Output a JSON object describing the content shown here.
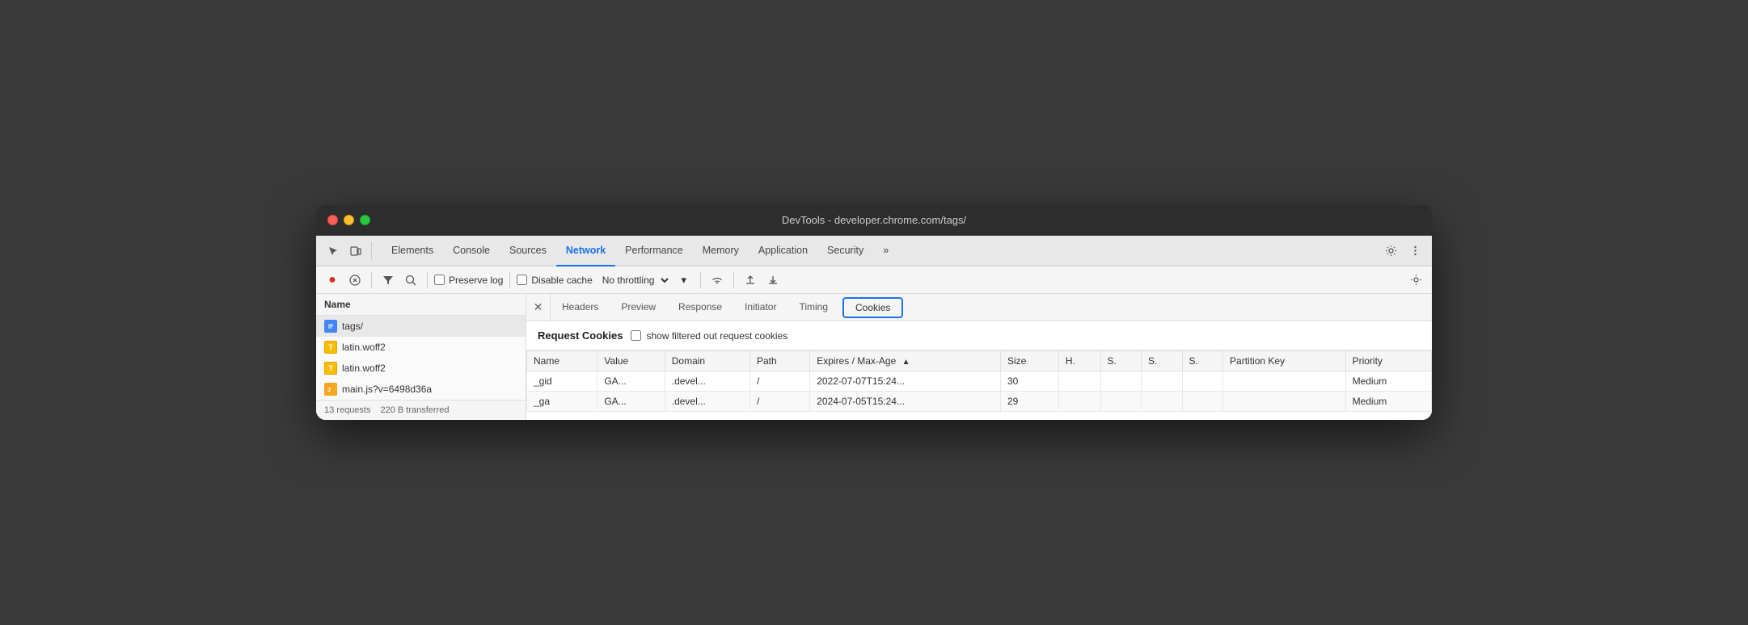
{
  "window": {
    "title": "DevTools - developer.chrome.com/tags/"
  },
  "tabs_bar": {
    "tabs": [
      {
        "label": "Elements",
        "active": false
      },
      {
        "label": "Console",
        "active": false
      },
      {
        "label": "Sources",
        "active": false
      },
      {
        "label": "Network",
        "active": true
      },
      {
        "label": "Performance",
        "active": false
      },
      {
        "label": "Memory",
        "active": false
      },
      {
        "label": "Application",
        "active": false
      },
      {
        "label": "Security",
        "active": false
      }
    ],
    "more_label": "»"
  },
  "toolbar": {
    "preserve_log": "Preserve log",
    "disable_cache": "Disable cache",
    "throttling": "No throttling"
  },
  "left_panel": {
    "header": "Name",
    "files": [
      {
        "name": "tags/",
        "type": "html"
      },
      {
        "name": "latin.woff2",
        "type": "font"
      },
      {
        "name": "latin.woff2",
        "type": "font"
      },
      {
        "name": "main.js?v=6498d36a",
        "type": "js"
      }
    ],
    "status": {
      "requests": "13 requests",
      "transferred": "220 B transferred"
    }
  },
  "request_tabs": {
    "tabs": [
      {
        "label": "Headers"
      },
      {
        "label": "Preview"
      },
      {
        "label": "Response"
      },
      {
        "label": "Initiator"
      },
      {
        "label": "Timing"
      },
      {
        "label": "Cookies",
        "active": true
      }
    ]
  },
  "cookies": {
    "section_title": "Request Cookies",
    "show_filtered_label": "show filtered out request cookies",
    "table": {
      "columns": [
        {
          "label": "Name",
          "key": "name"
        },
        {
          "label": "Value",
          "key": "value"
        },
        {
          "label": "Domain",
          "key": "domain"
        },
        {
          "label": "Path",
          "key": "path"
        },
        {
          "label": "Expires / Max-Age",
          "key": "expires",
          "sorted": "asc"
        },
        {
          "label": "Size",
          "key": "size"
        },
        {
          "label": "H.",
          "key": "h"
        },
        {
          "label": "S.",
          "key": "s1"
        },
        {
          "label": "S.",
          "key": "s2"
        },
        {
          "label": "S.",
          "key": "s3"
        },
        {
          "label": "Partition Key",
          "key": "partition_key"
        },
        {
          "label": "Priority",
          "key": "priority"
        }
      ],
      "rows": [
        {
          "name": "_gid",
          "value": "GA...",
          "domain": ".devel...",
          "path": "/",
          "expires": "2022-07-07T15:24...",
          "size": "30",
          "h": "",
          "s1": "",
          "s2": "",
          "s3": "",
          "partition_key": "",
          "priority": "Medium"
        },
        {
          "name": "_ga",
          "value": "GA...",
          "domain": ".devel...",
          "path": "/",
          "expires": "2024-07-05T15:24...",
          "size": "29",
          "h": "",
          "s1": "",
          "s2": "",
          "s3": "",
          "partition_key": "",
          "priority": "Medium"
        }
      ]
    }
  }
}
